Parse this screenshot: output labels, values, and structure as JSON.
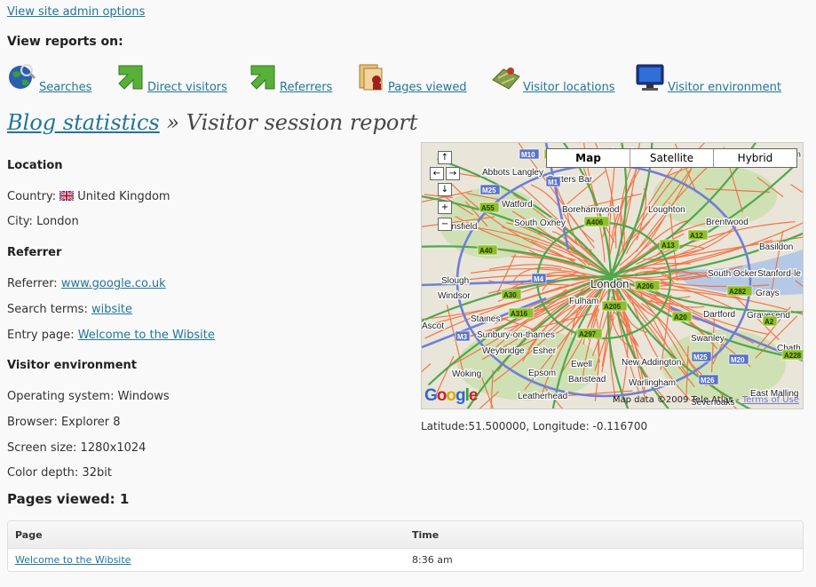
{
  "admin_link": "View site admin options",
  "view_reports_label": "View reports on:",
  "nav": [
    {
      "label": "Searches",
      "icon": "globe-search-icon"
    },
    {
      "label": "Direct visitors",
      "icon": "green-arrow-icon"
    },
    {
      "label": "Referrers",
      "icon": "green-arrow-icon"
    },
    {
      "label": "Pages viewed",
      "icon": "pages-icon"
    },
    {
      "label": "Visitor locations",
      "icon": "map-icon"
    },
    {
      "label": "Visitor environment",
      "icon": "monitor-icon"
    }
  ],
  "title": {
    "link": "Blog statistics",
    "rest": " » Visitor session report"
  },
  "location": {
    "heading": "Location",
    "country_label": "Country:",
    "country": "United Kingdom",
    "city_label": "City:",
    "city": "London"
  },
  "referrer": {
    "heading": "Referrer",
    "referrer_label": "Referrer:",
    "referrer": "www.google.co.uk",
    "search_label": "Search terms:",
    "search": "wibsite",
    "entry_label": "Entry page:",
    "entry": "Welcome to the Wibsite"
  },
  "environment": {
    "heading": "Visitor environment",
    "os": "Operating system: Windows",
    "browser": "Browser: Explorer 8",
    "screen": "Screen size: 1280x1024",
    "color": "Color depth: 32bit"
  },
  "pages_viewed": "Pages viewed: 1",
  "table": {
    "headers": [
      "Page",
      "Time"
    ],
    "rows": [
      {
        "page": "Welcome to the Wibsite",
        "time": "8:36 am"
      }
    ]
  },
  "map": {
    "buttons": [
      "Map",
      "Satellite",
      "Hybrid"
    ],
    "credit": "Map data ©2009 Tele Atlas -",
    "terms": "Terms of Use",
    "logo": "Google",
    "places": [
      {
        "label": "Hoddesdon"
      },
      {
        "label": "Chelm"
      },
      {
        "label": "Abbots Langley"
      },
      {
        "label": "Potters Bar"
      },
      {
        "label": "Watford"
      },
      {
        "label": "Borehamwood"
      },
      {
        "label": "Loughton"
      },
      {
        "label": "South Oxhey"
      },
      {
        "label": "Brentwood"
      },
      {
        "label": "Basildon"
      },
      {
        "label": "Slough"
      },
      {
        "label": "Windsor"
      },
      {
        "label": "London"
      },
      {
        "label": "South Ockendon"
      },
      {
        "label": "Stanford-le"
      },
      {
        "label": "Fulham"
      },
      {
        "label": "Grays"
      },
      {
        "label": "Staines"
      },
      {
        "label": "Dartford"
      },
      {
        "label": "Gravesend"
      },
      {
        "label": "Ascot"
      },
      {
        "label": "Sunbury-on-thames"
      },
      {
        "label": "Swanley"
      },
      {
        "label": "Chath"
      },
      {
        "label": "Weybridge"
      },
      {
        "label": "Esher"
      },
      {
        "label": "New Addington"
      },
      {
        "label": "Woking"
      },
      {
        "label": "Epsom"
      },
      {
        "label": "Ewell"
      },
      {
        "label": "Warlingham"
      },
      {
        "label": "East Malling"
      },
      {
        "label": "Leatherhead"
      },
      {
        "label": "Banstead"
      },
      {
        "label": "Sevenoaks"
      },
      {
        "label": "onsfield"
      }
    ],
    "road_labels": [
      "M10",
      "A414",
      "M1",
      "M25",
      "A406",
      "A12",
      "A13",
      "A40",
      "M4",
      "A206",
      "A282",
      "A30",
      "A316",
      "A205",
      "A20",
      "A2",
      "M3",
      "A297",
      "M25",
      "M20",
      "A228",
      "M26",
      "A55"
    ]
  },
  "coords": "Latitude:51.500000, Longitude: -0.116700"
}
